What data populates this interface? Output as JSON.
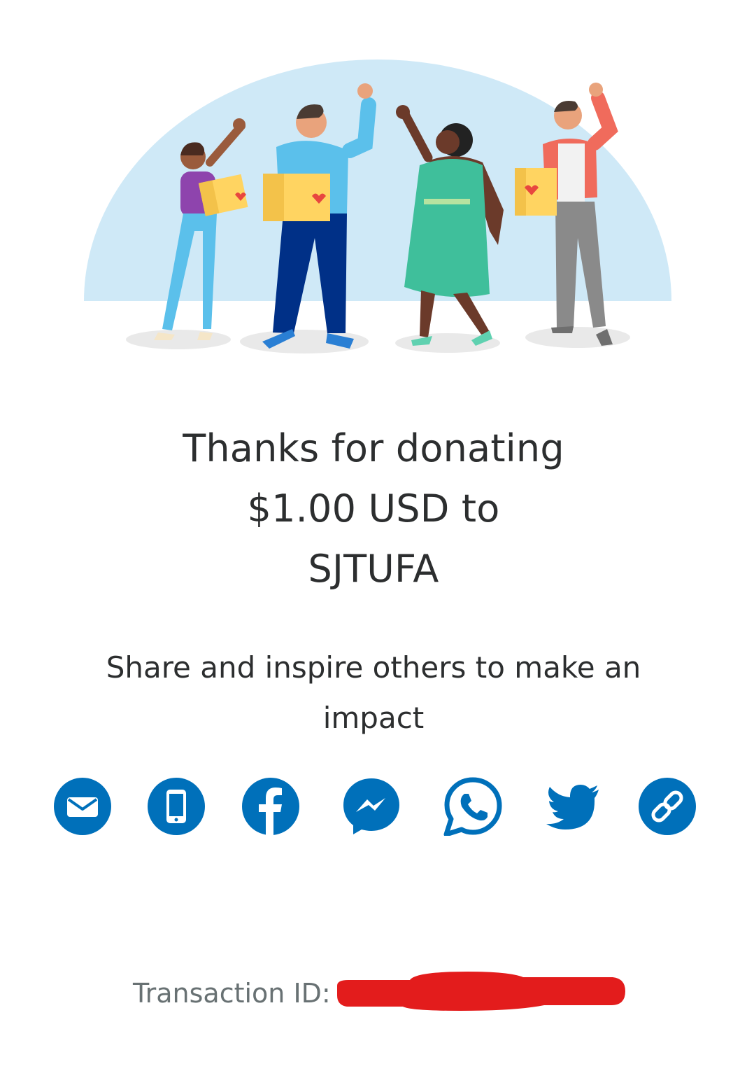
{
  "hero": {
    "illustration": "four-people-holding-donation-boxes-waving",
    "colors": {
      "dome": "#cfe9f7",
      "box": "#ffd461",
      "heart": "#e8473f"
    }
  },
  "headline": {
    "line1": "Thanks for donating",
    "line2": "$1.00 USD to",
    "line3": "SJTUFA"
  },
  "subtext": "Share and inspire others to make an impact",
  "share": {
    "accent": "#0070ba",
    "buttons": [
      {
        "icon": "email-icon"
      },
      {
        "icon": "sms-icon"
      },
      {
        "icon": "facebook-icon"
      },
      {
        "icon": "messenger-icon"
      },
      {
        "icon": "whatsapp-icon"
      },
      {
        "icon": "twitter-icon"
      },
      {
        "icon": "copy-link-icon"
      }
    ]
  },
  "transaction": {
    "label": "Transaction ID:",
    "redaction_color": "#e31c1c"
  }
}
